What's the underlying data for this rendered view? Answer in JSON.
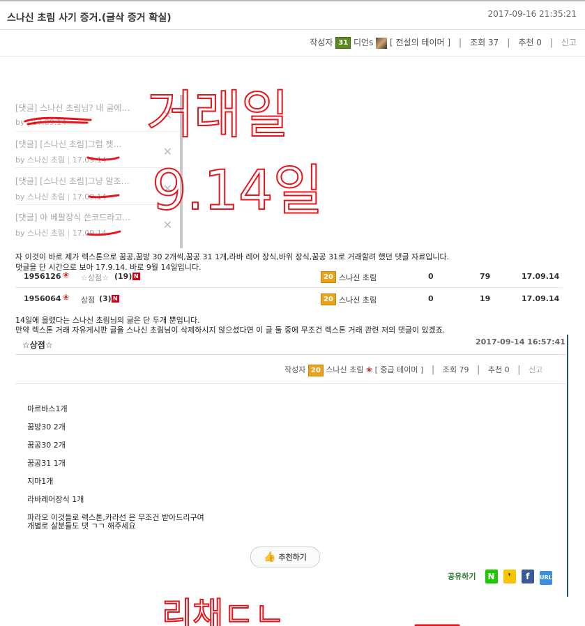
{
  "post": {
    "title": "스나신 초림 사기 증거.(글삭 증거 확실)",
    "date": "2017-09-16 21:35:21",
    "author_label": "작성자",
    "author_level": "31",
    "author_name": "디언s",
    "author_rank": "[ 전설의 테이머 ]",
    "views": "조회 37",
    "recommend": "추천 0",
    "report": "신고"
  },
  "comments": [
    {
      "text": "[댓글] 스나신 초림님? 내 글에…",
      "by": "by ",
      "date": "17.09.14"
    },
    {
      "text": "[댓글] [스나신 초림]그럼 젯…",
      "by": "by 스나신 초림",
      "date": "17.09.14"
    },
    {
      "text": "[댓글] [스나신 초림]그냥 알조…",
      "by": "by 스나신 초림",
      "date": "17.09.14"
    },
    {
      "text": "[댓글] 아 베팔장식 쓴코드라고…",
      "by": "by 스나신 초림",
      "date": "17.09.14"
    }
  ],
  "body_text": {
    "line1": "자 이것이 바로 제가 렉스톤으로 꿈공,꿈방 30 2개씩,꿈공 31 1개,라바 레어 장식,바위 장식,꿈공 31로 거래할려 했던 댓글 자료입니다.",
    "line2": "댓글을 단 시간으로 보아 17.9.14. 바로 9월 14일입니다.",
    "line3": "14일에 올렸다는 스나신 초림님의 글은 단 두개 뿐입니다.",
    "line4": "만약 렉스톤 거래 자유게시판 글을 스나신 초림님이 삭제하시지 않으셨다면 이 글 둘 중에 무조건 렉스톤 거래 관련 저의 댓글이 있겠죠."
  },
  "list_rows": [
    {
      "id": "1956126",
      "title": "☆상점☆",
      "count": "(19)",
      "new_badge": "N",
      "level": "20",
      "author": "스나신 초림",
      "col1": "0",
      "col2": "79",
      "date": "17.09.14"
    },
    {
      "id": "1956064",
      "title": "상점",
      "count": "(3)",
      "new_badge": "N",
      "level": "20",
      "author": "스나신 초림",
      "col1": "0",
      "col2": "19",
      "date": "17.09.14"
    }
  ],
  "inner_post": {
    "title": "☆상점☆",
    "date": "2017-09-14 16:57:41",
    "author_label": "작성자",
    "author_level": "20",
    "author_name": "스나신 초림",
    "author_rank": "[ 중급 테이머 ]",
    "views": "조회 79",
    "recommend": "추천 0",
    "report": "신고",
    "lines": [
      "마르바스1개",
      "꿈방30  2개",
      "꿈공30  2개",
      "꿈공31  1개",
      "지마1개",
      "라바레어장식 1개"
    ],
    "closing1": "파라오 이것들로 렉스톤,카라선  은 무조건 받아드리구여",
    "closing2": "개별로 살분들도 댓 ㄱㄱ 해주세요",
    "recommend_button": "추천하기",
    "share_label": "공유하기",
    "share_icons": {
      "naver": "N",
      "talk": "❜",
      "facebook": "f",
      "url": "URL"
    }
  },
  "handwriting": {
    "top": "거래일",
    "middle": "9.14일",
    "bottom": "리채ㄷㄴ"
  },
  "colors": {
    "handwriting": "#e8141c",
    "share_label": "#2e7d32",
    "new_badge": "#d0021b",
    "level_green": "#5a8a1f",
    "level_orange": "#e8a21c"
  }
}
